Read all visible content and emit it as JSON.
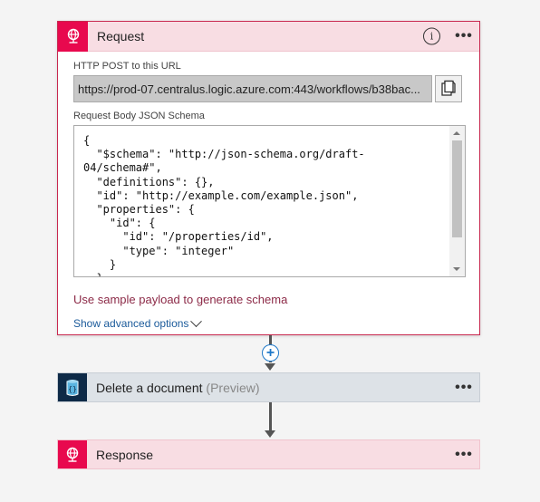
{
  "request": {
    "title": "Request",
    "icon": "globe-icon",
    "url_label": "HTTP POST to this URL",
    "url_value": "https://prod-07.centralus.logic.azure.com:443/workflows/b38bac...",
    "schema_label": "Request Body JSON Schema",
    "schema_lines": [
      "{",
      "  \"$schema\": \"http://json-schema.org/draft-",
      "04/schema#\",",
      "  \"definitions\": {},",
      "  \"id\": \"http://example.com/example.json\",",
      "  \"properties\": {",
      "    \"id\": {",
      "      \"id\": \"/properties/id\",",
      "      \"type\": \"integer\"",
      "    }",
      "  }"
    ],
    "sample_link": "Use sample payload to generate schema",
    "advanced_link": "Show advanced options",
    "info_glyph": "i",
    "menu_glyph": "•••"
  },
  "add_step": {
    "glyph": "+"
  },
  "delete_step": {
    "title": "Delete a document",
    "suffix": "(Preview)",
    "icon": "cosmos-db-icon",
    "menu_glyph": "•••"
  },
  "response_step": {
    "title": "Response",
    "icon": "globe-icon",
    "menu_glyph": "•••"
  },
  "colors": {
    "request_accent": "#e8094e",
    "request_border": "#c8284f",
    "link_red": "#8c2a47",
    "link_blue": "#1a5a9a",
    "cosmos_tile": "#0e2a47"
  }
}
